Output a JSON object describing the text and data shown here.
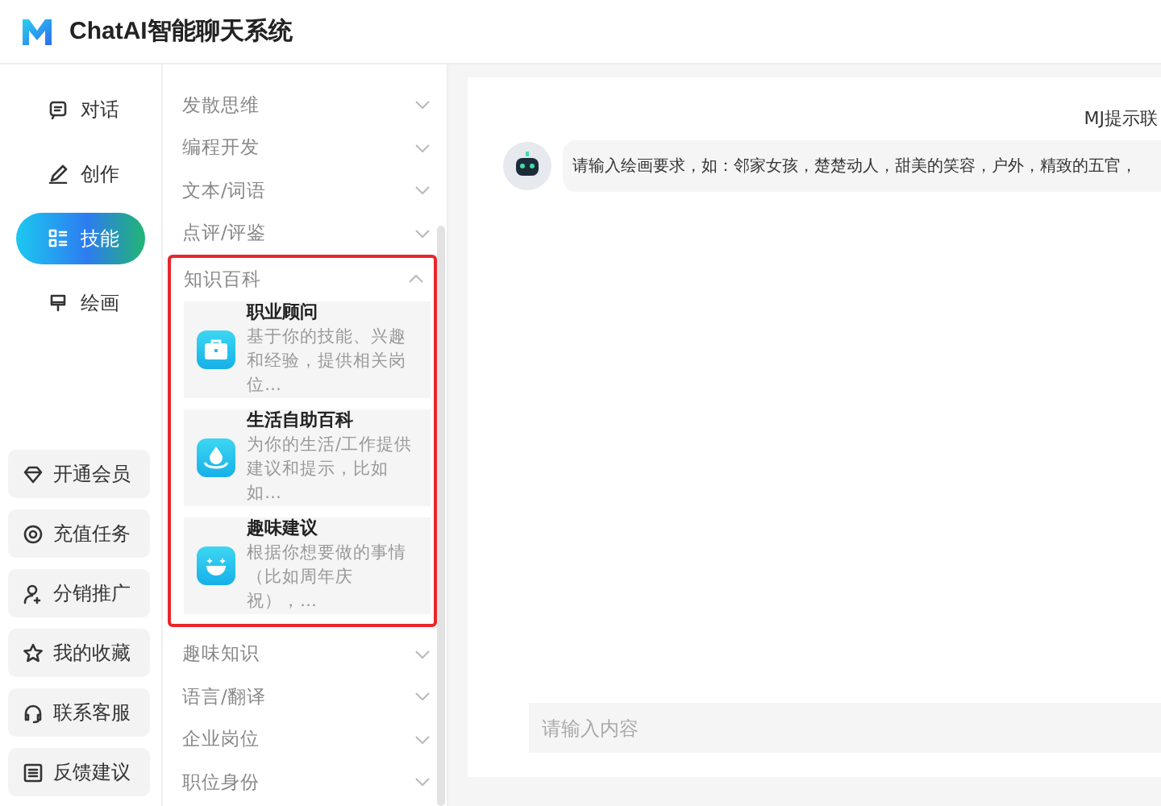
{
  "app": {
    "title": "ChatAI智能聊天系统"
  },
  "nav": [
    {
      "label": "对话",
      "kind": "chat",
      "selected": false
    },
    {
      "label": "创作",
      "kind": "pen",
      "selected": false
    },
    {
      "label": "技能",
      "kind": "grid",
      "selected": true
    },
    {
      "label": "绘画",
      "kind": "brush",
      "selected": false
    }
  ],
  "member_links": [
    {
      "label": "开通会员",
      "kind": "diamond"
    },
    {
      "label": "充值任务",
      "kind": "target"
    },
    {
      "label": "分销推广",
      "kind": "user"
    },
    {
      "label": "我的收藏",
      "kind": "star"
    },
    {
      "label": "联系客服",
      "kind": "headset"
    },
    {
      "label": "反馈建议",
      "kind": "doc"
    }
  ],
  "categories": [
    {
      "label": "发散思维",
      "expanded": false,
      "highlighted": false
    },
    {
      "label": "编程开发",
      "expanded": false,
      "highlighted": false
    },
    {
      "label": "文本/词语",
      "expanded": false,
      "highlighted": false
    },
    {
      "label": "点评/评鉴",
      "expanded": false,
      "highlighted": false
    },
    {
      "label": "知识百科",
      "expanded": true,
      "highlighted": true,
      "skills": [
        {
          "title": "职业顾问",
          "description": "基于你的技能、兴趣和经验，提供相关岗位…",
          "kind": "briefcase"
        },
        {
          "title": "生活自助百科",
          "description": "为你的生活/工作提供建议和提示，比如如…",
          "kind": "drop"
        },
        {
          "title": "趣味建议",
          "description": "根据你想要做的事情（比如周年庆祝），…",
          "kind": "smile"
        }
      ]
    },
    {
      "label": "趣味知识",
      "expanded": false,
      "highlighted": false
    },
    {
      "label": "语言/翻译",
      "expanded": false,
      "highlighted": false
    },
    {
      "label": "企业岗位",
      "expanded": false,
      "highlighted": false
    },
    {
      "label": "职位身份",
      "expanded": false,
      "highlighted": false
    }
  ],
  "chat": {
    "header": "MJ提示联",
    "messages": [
      {
        "text": "请输入绘画要求，如：邻家女孩，楚楚动人，甜美的笑容，户外，精致的五官，"
      }
    ],
    "input": {
      "placeholder": "请输入内容"
    }
  }
}
